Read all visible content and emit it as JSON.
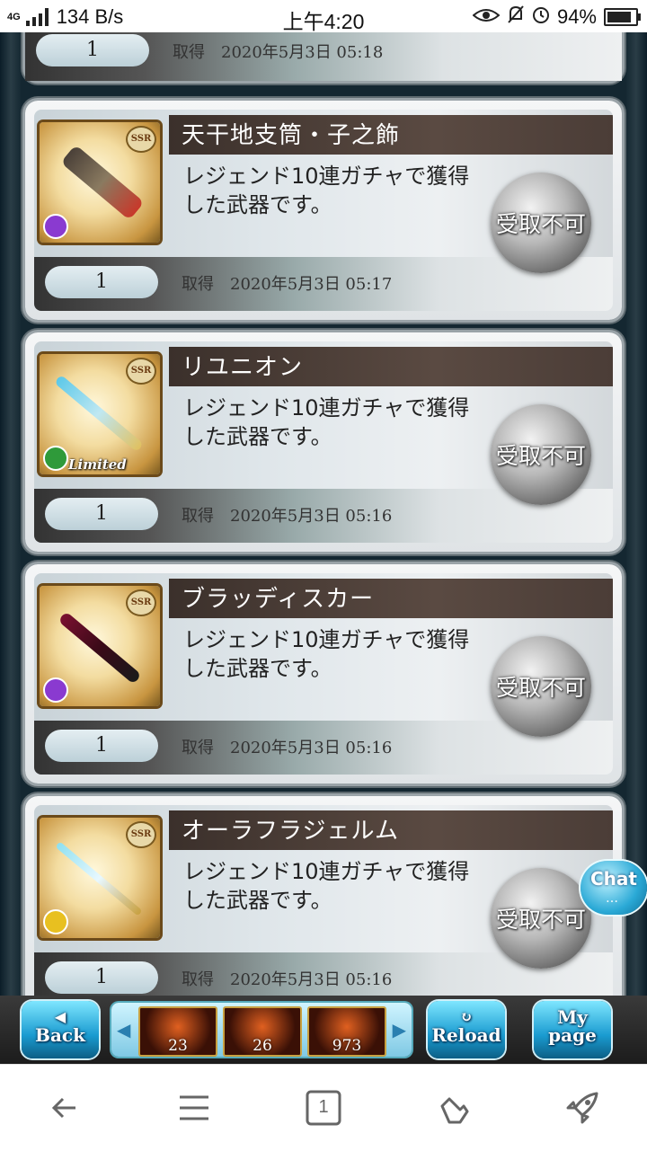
{
  "status_bar": {
    "network": "4G",
    "speed": "134 B/s",
    "time": "上午4:20",
    "battery": "94%"
  },
  "top_partial": {
    "quantity": "1",
    "acquired_label": "取得",
    "acquired_time": "2020年5月3日 05:18"
  },
  "items": [
    {
      "name": "天干地支筒・子之飾",
      "description": "レジェンド10連ガチャで獲得した武器です。",
      "quantity": "1",
      "acquired_label": "取得",
      "acquired_time": "2020年5月3日 05:17",
      "button": "受取不可",
      "rarity": "SSR",
      "element_color": "#8a3ad0",
      "limited": ""
    },
    {
      "name": "リユニオン",
      "description": "レジェンド10連ガチャで獲得した武器です。",
      "quantity": "1",
      "acquired_label": "取得",
      "acquired_time": "2020年5月3日 05:16",
      "button": "受取不可",
      "rarity": "SSR",
      "element_color": "#2f9a3a",
      "limited": "Limited"
    },
    {
      "name": "ブラッディスカー",
      "description": "レジェンド10連ガチャで獲得した武器です。",
      "quantity": "1",
      "acquired_label": "取得",
      "acquired_time": "2020年5月3日 05:16",
      "button": "受取不可",
      "rarity": "SSR",
      "element_color": "#8a3ad0",
      "limited": ""
    },
    {
      "name": "オーラフラジェルム",
      "description": "レジェンド10連ガチャで獲得した武器です。",
      "quantity": "1",
      "acquired_label": "取得",
      "acquired_time": "2020年5月3日 05:16",
      "button": "受取不可",
      "rarity": "SSR",
      "element_color": "#e8c020",
      "limited": ""
    }
  ],
  "chat": {
    "label": "Chat",
    "dots": "…"
  },
  "game_nav": {
    "back": {
      "top": "◀",
      "bottom": "Back"
    },
    "resources": [
      "23",
      "26",
      "973"
    ],
    "reload": {
      "top": "↻",
      "bottom": "Reload"
    },
    "mypage": {
      "top": "My",
      "bottom": "page"
    }
  },
  "browser_nav": {
    "tab_count": "1",
    "icons": [
      "back-arrow-icon",
      "menu-icon",
      "tabs-icon",
      "gesture-hand-icon",
      "rocket-icon"
    ]
  }
}
